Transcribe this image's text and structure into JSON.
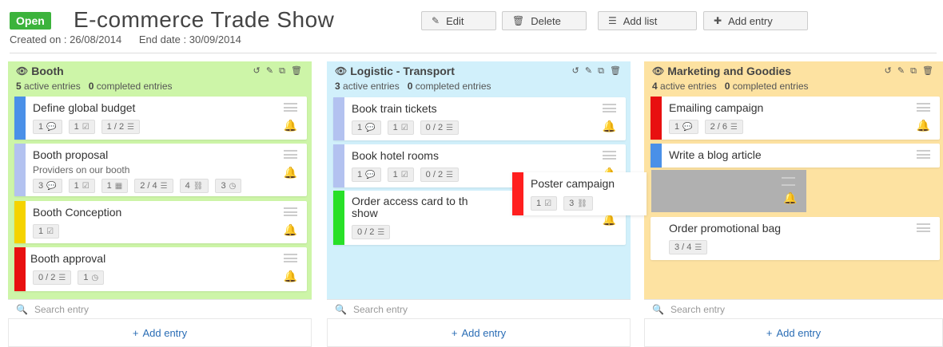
{
  "header": {
    "status": "Open",
    "title": "E-commerce Trade Show",
    "buttons": {
      "edit": "Edit",
      "delete": "Delete",
      "add_list": "Add list",
      "add_entry": "Add entry"
    },
    "created": "Created on : 26/08/2014",
    "end": "End date : 30/09/2014"
  },
  "colors": {
    "green": "#3cb33c",
    "blue_bar": "#4a90e8",
    "lavender_bar": "#b3c2f0",
    "yellow_bar": "#f5d300",
    "red_bar": "#e81010",
    "lime_bar": "#28e028",
    "link": "#2a6db5"
  },
  "lists": [
    {
      "title": "Booth",
      "active_count": "5",
      "active_label": "active entries",
      "completed_count": "0",
      "completed_label": "completed entries",
      "search_placeholder": "Search entry",
      "add_label": "Add entry",
      "cards": [
        {
          "title": "Define global budget",
          "badges": [
            "1",
            "1",
            "1 / 2"
          ]
        },
        {
          "title": "Booth proposal",
          "subtitle": "Providers on our booth",
          "badges": [
            "3",
            "1",
            "1",
            "2 / 4",
            "4",
            "3"
          ]
        },
        {
          "title": "Booth Conception",
          "badges": [
            "1"
          ]
        },
        {
          "title": "Booth approval",
          "badges": [
            "0 / 2",
            "1"
          ]
        }
      ]
    },
    {
      "title": "Logistic - Transport",
      "active_count": "3",
      "active_label": "active entries",
      "completed_count": "0",
      "completed_label": "completed entries",
      "search_placeholder": "Search entry",
      "add_label": "Add entry",
      "cards": [
        {
          "title": "Book train tickets",
          "badges": [
            "1",
            "1",
            "0 / 2"
          ]
        },
        {
          "title": "Book hotel rooms",
          "badges": [
            "1",
            "1",
            "0 / 2"
          ]
        },
        {
          "title": "Order access card to th",
          "title2": "show",
          "badges": [
            "0 / 2"
          ]
        }
      ]
    },
    {
      "title": "Marketing and Goodies",
      "active_count": "4",
      "active_label": "active entries",
      "completed_count": "0",
      "completed_label": "completed entries",
      "search_placeholder": "Search entry",
      "add_label": "Add entry",
      "cards": [
        {
          "title": "Emailing campaign",
          "badges": [
            "1",
            "2 / 6"
          ]
        },
        {
          "title": "Write a blog article"
        },
        {
          "title": "Order promotional bag",
          "badges": [
            "3 / 4"
          ]
        }
      ]
    }
  ],
  "dragging": {
    "title": "Poster campaign",
    "badges": [
      "1",
      "3"
    ]
  }
}
